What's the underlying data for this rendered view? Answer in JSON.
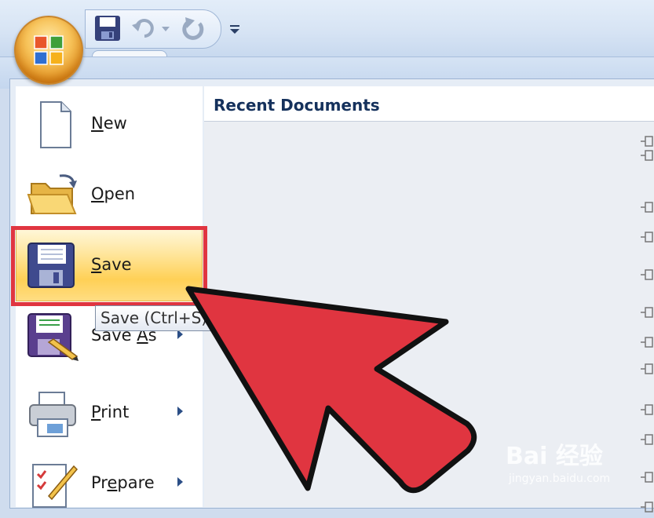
{
  "menu": {
    "items": [
      {
        "label_before": "",
        "accel": "N",
        "label_after": "ew",
        "has_submenu": false
      },
      {
        "label_before": "",
        "accel": "O",
        "label_after": "pen",
        "has_submenu": false
      },
      {
        "label_before": "",
        "accel": "S",
        "label_after": "ave",
        "has_submenu": false
      },
      {
        "label_before": "Save ",
        "accel": "A",
        "label_after": "s",
        "has_submenu": true
      },
      {
        "label_before": "",
        "accel": "P",
        "label_after": "rint",
        "has_submenu": true
      },
      {
        "label_before": "Pr",
        "accel": "e",
        "label_after": "pare",
        "has_submenu": true
      }
    ],
    "tooltip": "Save (Ctrl+S)"
  },
  "recent": {
    "title": "Recent Documents"
  },
  "watermark": {
    "brand": "Bai 经验",
    "url": "jingyan.baidu.com"
  },
  "colors": {
    "highlight": "#e03540",
    "arrow": "#e03540",
    "heading": "#15315c"
  },
  "icons": {
    "qat": [
      "save-icon",
      "undo-icon",
      "undo-dropdown-icon",
      "redo-icon",
      "customize-qat-icon"
    ],
    "menu": [
      "new-document-icon",
      "open-folder-icon",
      "save-disk-icon",
      "save-as-icon",
      "printer-icon",
      "prepare-icon"
    ]
  }
}
